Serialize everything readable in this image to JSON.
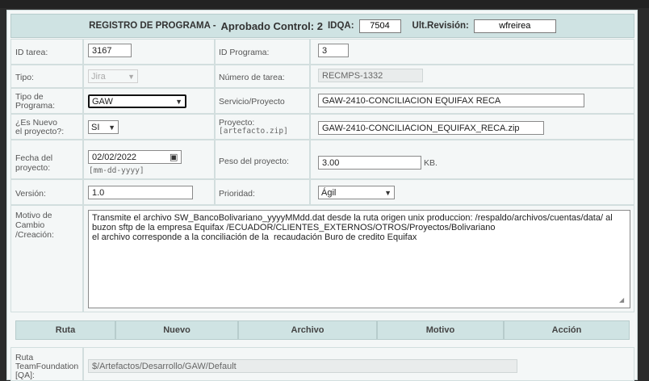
{
  "header": {
    "title": "REGISTRO DE PROGRAMA -",
    "status": "Aprobado Control: 2",
    "idqa_label": "IDQA:",
    "idqa_value": "7504",
    "rev_label": "Ult.Revisión:",
    "rev_value": "wfreirea"
  },
  "form": {
    "id_tarea": {
      "label": "ID tarea:",
      "value": "3167"
    },
    "id_programa": {
      "label": "ID Programa:",
      "value": "3"
    },
    "tipo": {
      "label": "Tipo:",
      "value": "Jira"
    },
    "numero_tarea": {
      "label": "Número de tarea:",
      "value": "RECMPS-1332"
    },
    "tipo_programa": {
      "label_1": "Tipo de",
      "label_2": "Programa:",
      "value": "GAW"
    },
    "servicio": {
      "label": "Servicio/Proyecto",
      "value": "GAW-2410-CONCILIACION EQUIFAX RECA"
    },
    "es_nuevo": {
      "label_1": "¿Es Nuevo",
      "label_2": "el proyecto?:",
      "value": "SI"
    },
    "proyecto": {
      "label_1": "Proyecto:",
      "label_2": "[artefacto.zip]",
      "value": "GAW-2410-CONCILIACION_EQUIFAX_RECA.zip"
    },
    "fecha": {
      "label_1": "Fecha del",
      "label_2": "proyecto:",
      "value": "02/02/2022",
      "hint": "[mm-dd-yyyy]"
    },
    "peso": {
      "label": "Peso del proyecto:",
      "value": "3.00",
      "unit": "KB."
    },
    "version": {
      "label": "Versión:",
      "value": "1.0"
    },
    "prioridad": {
      "label": "Prioridad:",
      "value": "Ágil"
    },
    "motivo": {
      "label_1": "Motivo de",
      "label_2": "Cambio",
      "label_3": "/Creación:",
      "value": "Transmite el archivo SW_BancoBolivariano_yyyyMMdd.dat desde la ruta origen unix produccion: /respaldo/archivos/cuentas/data/ al buzon sftp de la empresa Equifax /ECUADOR/CLIENTES_EXTERNOS/OTROS/Proyectos/Bolivariano\nel archivo corresponde a la conciliación de la  recaudación Buro de credito Equifax"
    }
  },
  "table": {
    "headers": [
      "Ruta",
      "Nuevo",
      "Archivo",
      "Motivo",
      "Acción"
    ]
  },
  "ruta_tfs": {
    "label_1": "Ruta",
    "label_2": "TeamFoundation",
    "label_3": "[QA]:",
    "value": "$/Artefactos/Desarrollo/GAW/Default"
  },
  "icons": {
    "dropdown": "chevron-down-icon",
    "calendar": "calendar-icon",
    "resize": "resize-grip-icon"
  }
}
